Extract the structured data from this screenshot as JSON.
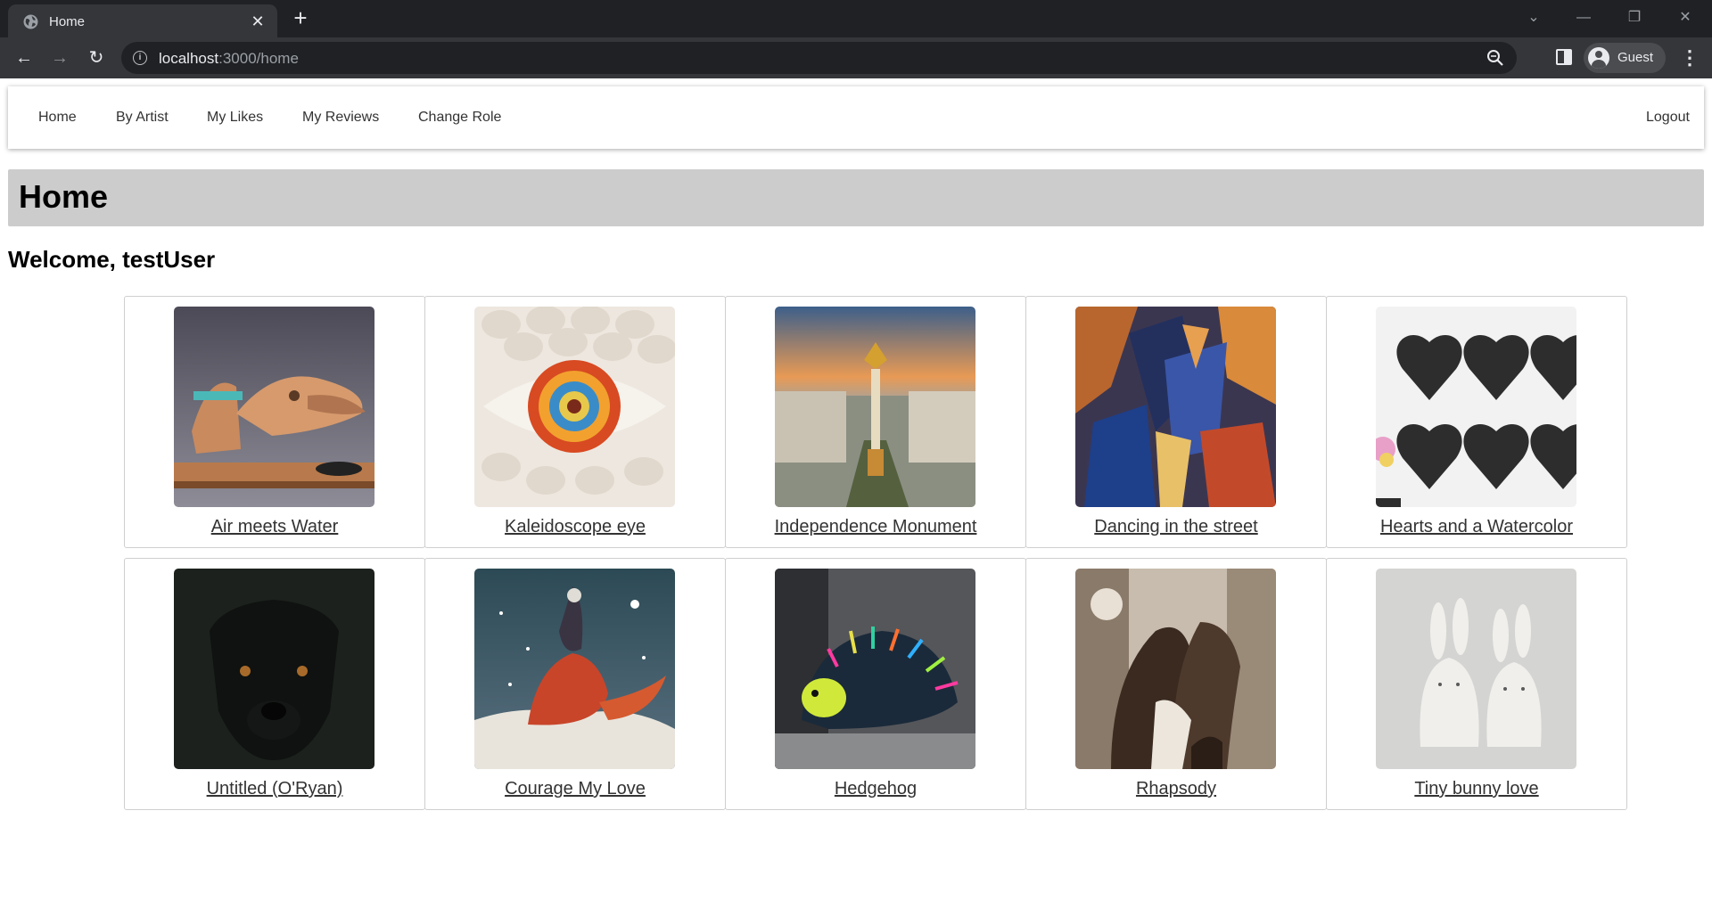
{
  "browser": {
    "tab_title": "Home",
    "url_host": "localhost",
    "url_path": ":3000/home",
    "profile_label": "Guest"
  },
  "nav": {
    "items": [
      "Home",
      "By Artist",
      "My Likes",
      "My Reviews",
      "Change Role"
    ],
    "logout": "Logout"
  },
  "page": {
    "title": "Home",
    "welcome": "Welcome, testUser"
  },
  "artworks": [
    {
      "title": "Air meets Water",
      "image": "carved-wooden-raven-sculpture"
    },
    {
      "title": "Kaleidoscope eye",
      "image": "mandala-eye-among-scales"
    },
    {
      "title": "Independence Monument",
      "image": "city-square-monument-at-sunset"
    },
    {
      "title": "Dancing in the street",
      "image": "cubist-dancing-couple"
    },
    {
      "title": "Hearts and a Watercolor",
      "image": "sketched-black-hearts"
    },
    {
      "title": "Untitled (O'Ryan)",
      "image": "black-dog-portrait"
    },
    {
      "title": "Courage My Love",
      "image": "red-fox-and-rider-in-snow"
    },
    {
      "title": "Hedgehog",
      "image": "colorful-embroidered-hedgehog"
    },
    {
      "title": "Rhapsody",
      "image": "sepia-couple-drawing"
    },
    {
      "title": "Tiny bunny love",
      "image": "two-white-ceramic-bunnies"
    }
  ]
}
